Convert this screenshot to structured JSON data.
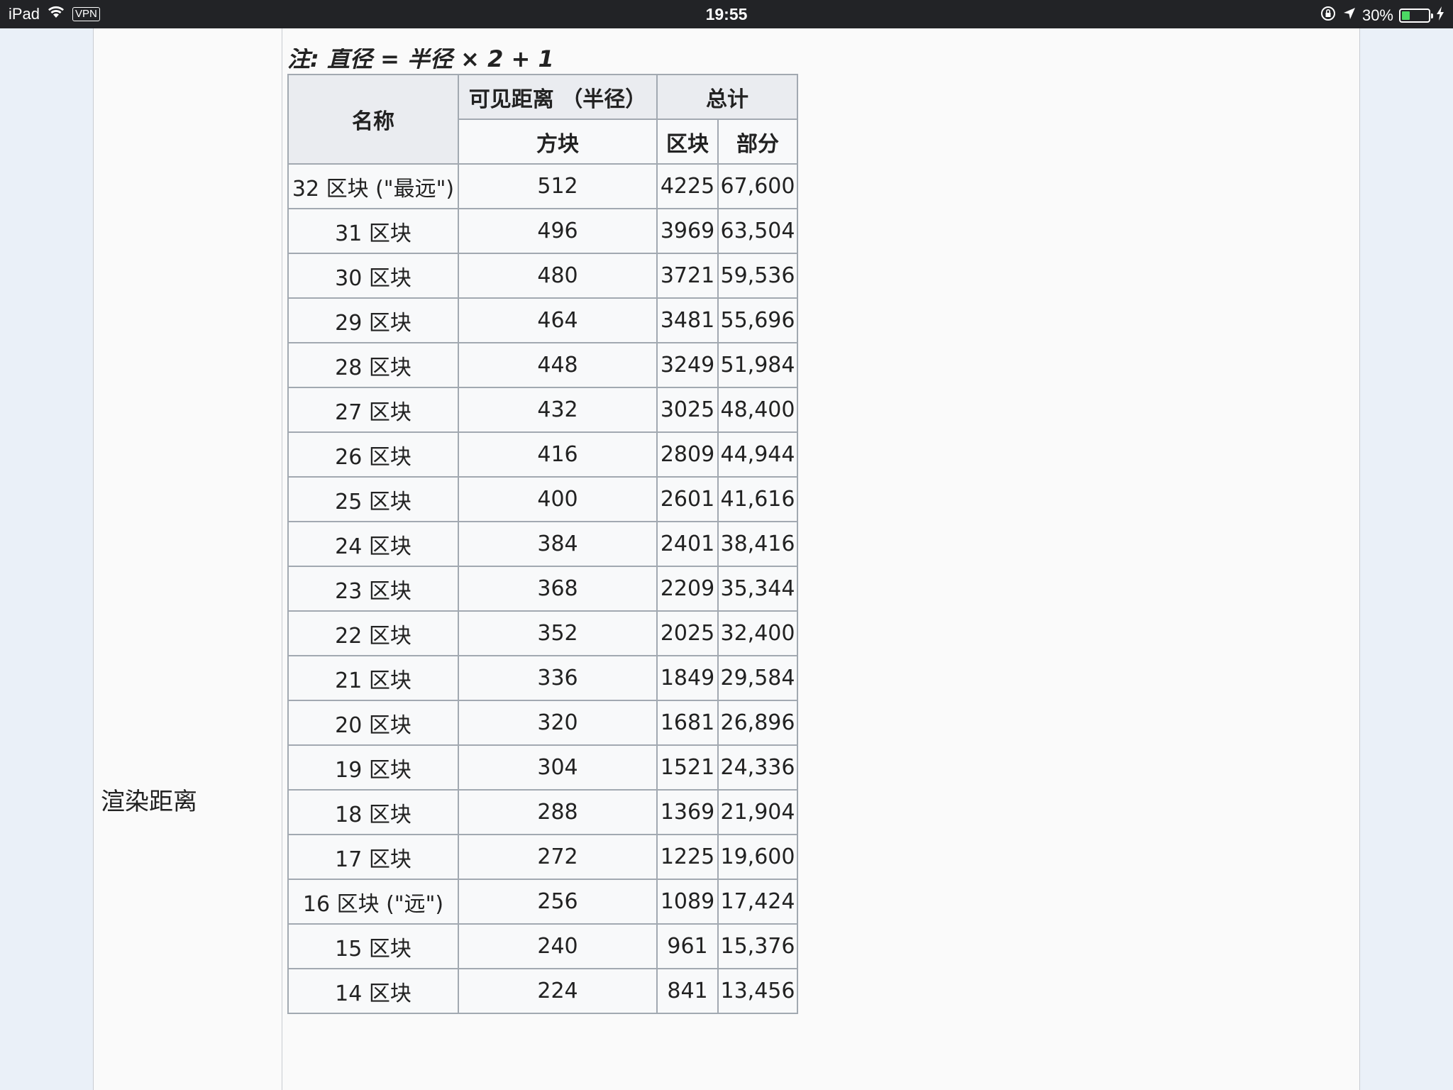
{
  "status_bar": {
    "device": "iPad",
    "vpn": "VPN",
    "time": "19:55",
    "battery_pct_label": "30%",
    "battery_level": 0.3,
    "battery_color": "#4cd964"
  },
  "section": {
    "row_label": "渲染距离",
    "note": "注: 直径 = 半径 × 2 + 1"
  },
  "table": {
    "headers": {
      "name": "名称",
      "visible_distance": "可见距离 （半径）",
      "total": "总计",
      "blocks": "方块",
      "chunks": "区块",
      "parts": "部分"
    },
    "rows": [
      {
        "name": "32 区块 (\"最远\")",
        "blocks": "512",
        "chunks": "4225",
        "parts": "67,600"
      },
      {
        "name": "31 区块",
        "blocks": "496",
        "chunks": "3969",
        "parts": "63,504"
      },
      {
        "name": "30 区块",
        "blocks": "480",
        "chunks": "3721",
        "parts": "59,536"
      },
      {
        "name": "29 区块",
        "blocks": "464",
        "chunks": "3481",
        "parts": "55,696"
      },
      {
        "name": "28 区块",
        "blocks": "448",
        "chunks": "3249",
        "parts": "51,984"
      },
      {
        "name": "27 区块",
        "blocks": "432",
        "chunks": "3025",
        "parts": "48,400"
      },
      {
        "name": "26 区块",
        "blocks": "416",
        "chunks": "2809",
        "parts": "44,944"
      },
      {
        "name": "25 区块",
        "blocks": "400",
        "chunks": "2601",
        "parts": "41,616"
      },
      {
        "name": "24 区块",
        "blocks": "384",
        "chunks": "2401",
        "parts": "38,416"
      },
      {
        "name": "23 区块",
        "blocks": "368",
        "chunks": "2209",
        "parts": "35,344"
      },
      {
        "name": "22 区块",
        "blocks": "352",
        "chunks": "2025",
        "parts": "32,400"
      },
      {
        "name": "21 区块",
        "blocks": "336",
        "chunks": "1849",
        "parts": "29,584"
      },
      {
        "name": "20 区块",
        "blocks": "320",
        "chunks": "1681",
        "parts": "26,896"
      },
      {
        "name": "19 区块",
        "blocks": "304",
        "chunks": "1521",
        "parts": "24,336"
      },
      {
        "name": "18 区块",
        "blocks": "288",
        "chunks": "1369",
        "parts": "21,904"
      },
      {
        "name": "17 区块",
        "blocks": "272",
        "chunks": "1225",
        "parts": "19,600"
      },
      {
        "name": "16 区块 (\"远\")",
        "blocks": "256",
        "chunks": "1089",
        "parts": "17,424"
      },
      {
        "name": "15 区块",
        "blocks": "240",
        "chunks": "961",
        "parts": "15,376"
      },
      {
        "name": "14 区块",
        "blocks": "224",
        "chunks": "841",
        "parts": "13,456"
      }
    ]
  }
}
